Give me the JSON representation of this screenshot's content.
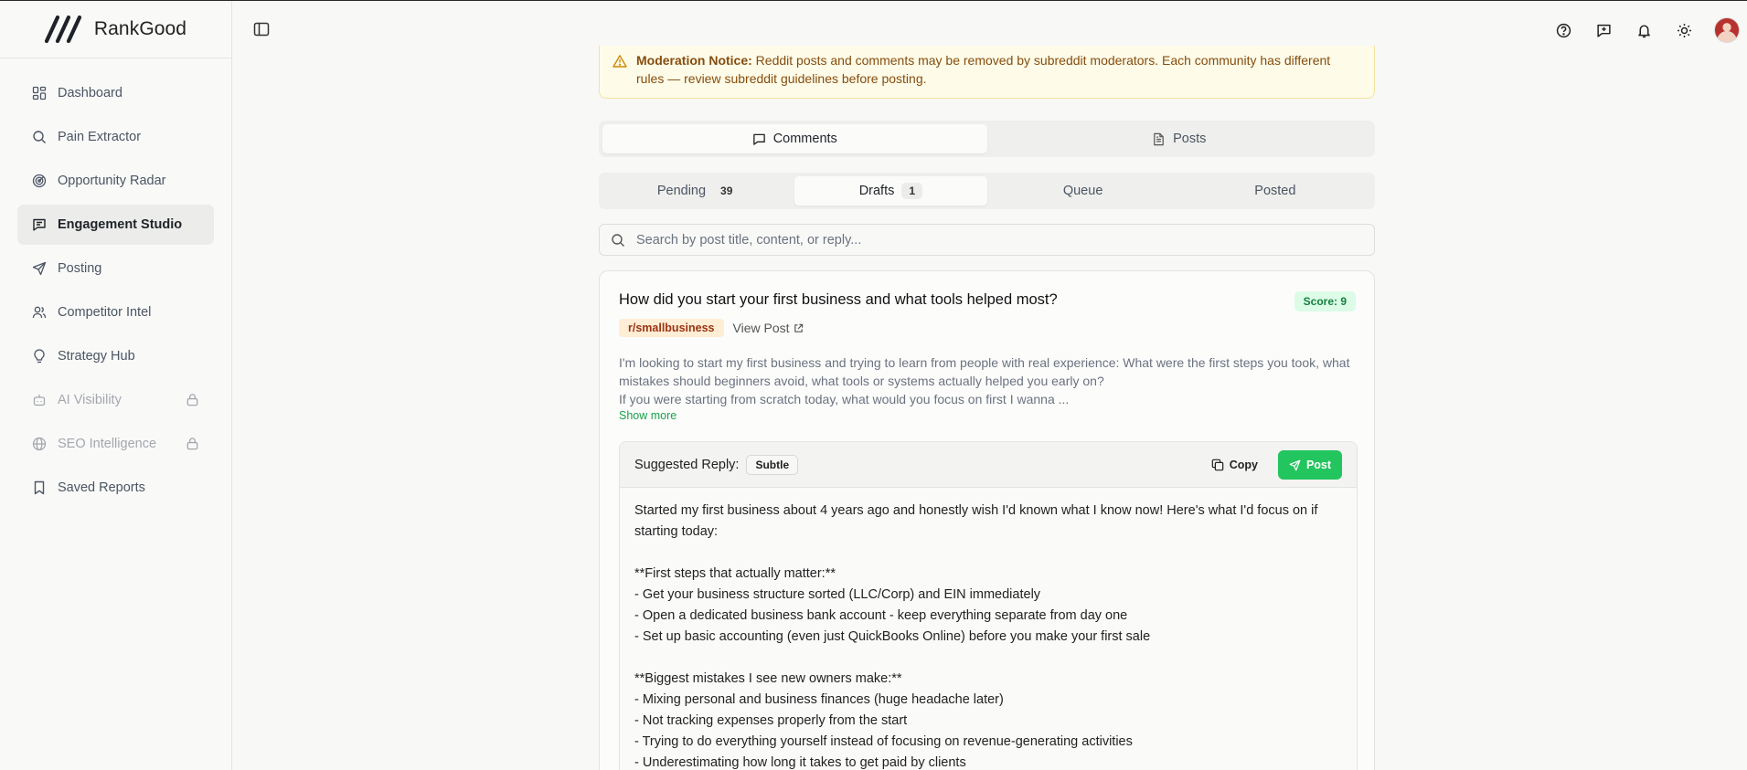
{
  "brand": {
    "name": "RankGood"
  },
  "sidebar": {
    "items": [
      {
        "label": "Dashboard",
        "icon": "dashboard-icon",
        "active": false,
        "locked": false
      },
      {
        "label": "Pain Extractor",
        "icon": "search-icon",
        "active": false,
        "locked": false
      },
      {
        "label": "Opportunity Radar",
        "icon": "radar-icon",
        "active": false,
        "locked": false
      },
      {
        "label": "Engagement Studio",
        "icon": "message-square-icon",
        "active": true,
        "locked": false
      },
      {
        "label": "Posting",
        "icon": "send-icon",
        "active": false,
        "locked": false
      },
      {
        "label": "Competitor Intel",
        "icon": "users-icon",
        "active": false,
        "locked": false
      },
      {
        "label": "Strategy Hub",
        "icon": "lightbulb-icon",
        "active": false,
        "locked": false
      },
      {
        "label": "AI Visibility",
        "icon": "bot-icon",
        "active": false,
        "locked": true
      },
      {
        "label": "SEO Intelligence",
        "icon": "globe-icon",
        "active": false,
        "locked": true
      },
      {
        "label": "Saved Reports",
        "icon": "bookmark-icon",
        "active": false,
        "locked": false
      }
    ]
  },
  "notice": {
    "title": "Moderation Notice:",
    "text": "Reddit posts and comments may be removed by subreddit moderators. Each community has different rules — review subreddit guidelines before posting."
  },
  "content_tabs": [
    {
      "label": "Comments",
      "icon": "message-square-icon",
      "active": true
    },
    {
      "label": "Posts",
      "icon": "file-text-icon",
      "active": false
    }
  ],
  "status_tabs": [
    {
      "label": "Pending",
      "count": "39",
      "active": false
    },
    {
      "label": "Drafts",
      "count": "1",
      "active": true
    },
    {
      "label": "Queue",
      "count": "",
      "active": false
    },
    {
      "label": "Posted",
      "count": "",
      "active": false
    }
  ],
  "search": {
    "placeholder": "Search by post title, content, or reply..."
  },
  "post": {
    "title": "How did you start your first business and what tools helped most?",
    "score": "Score: 9",
    "subreddit": "r/smallbusiness",
    "view_post": "View Post",
    "excerpt_1": "I'm looking to start my first business and trying to learn from people with real experience: What were the first steps you took, what mistakes should beginners avoid, what tools or systems actually helped you early on?",
    "excerpt_2": "If you were starting from scratch today, what would you focus on first I wanna ...",
    "show_more": "Show more"
  },
  "reply": {
    "label": "Suggested Reply:",
    "tone": "Subtle",
    "copy_label": "Copy",
    "post_label": "Post",
    "lines": [
      "Started my first business about 4 years ago and honestly wish I'd known what I know now! Here's what I'd focus on if starting today:",
      "",
      "**First steps that actually matter:**",
      "- Get your business structure sorted (LLC/Corp) and EIN immediately",
      "- Open a dedicated business bank account - keep everything separate from day one",
      "- Set up basic accounting (even just QuickBooks Online) before you make your first sale",
      "",
      "**Biggest mistakes I see new owners make:**",
      "- Mixing personal and business finances (huge headache later)",
      "- Not tracking expenses properly from the start",
      "- Trying to do everything yourself instead of focusing on revenue-generating activities",
      "- Underestimating how long it takes to get paid by clients"
    ]
  },
  "colors": {
    "accent_green": "#22c55e",
    "score_bg": "#dcfce7",
    "subreddit_bg": "#ffedd5",
    "notice_bg": "#fefbe8"
  }
}
